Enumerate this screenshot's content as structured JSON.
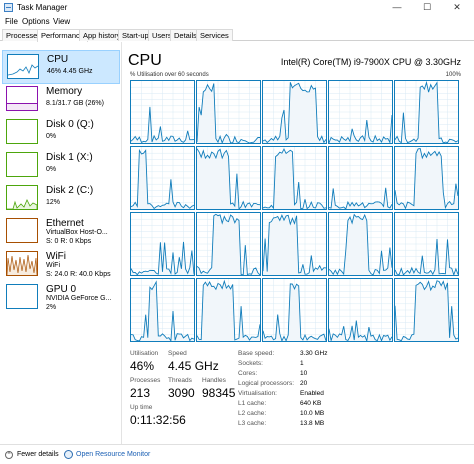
{
  "window": {
    "title": "Task Manager",
    "buttons": {
      "minimize": "—",
      "maximize": "☐",
      "close": "✕"
    }
  },
  "menu": [
    "File",
    "Options",
    "View"
  ],
  "tabs": [
    "Processes",
    "Performance",
    "App history",
    "Start-up",
    "Users",
    "Details",
    "Services"
  ],
  "active_tab": "Performance",
  "sidebar": [
    {
      "name": "CPU",
      "sub1": "46% 4.45 GHz",
      "sub2": "",
      "color": "#117dbb"
    },
    {
      "name": "Memory",
      "sub1": "8.1/31.7 GB (26%)",
      "sub2": "",
      "color": "#8b12ae"
    },
    {
      "name": "Disk 0 (Q:)",
      "sub1": "0%",
      "sub2": "",
      "color": "#4da60c"
    },
    {
      "name": "Disk 1 (X:)",
      "sub1": "0%",
      "sub2": "",
      "color": "#4da60c"
    },
    {
      "name": "Disk 2 (C:)",
      "sub1": "12%",
      "sub2": "",
      "color": "#4da60c"
    },
    {
      "name": "Ethernet",
      "sub1": "VirtualBox Host-O...",
      "sub2": "S: 0 R: 0 Kbps",
      "color": "#a74f01"
    },
    {
      "name": "WiFi",
      "sub1": "WiFi",
      "sub2": "S: 24.0 R: 40.0 Kbps",
      "color": "#a74f01"
    },
    {
      "name": "GPU 0",
      "sub1": "NVIDIA GeForce G...",
      "sub2": "2%",
      "color": "#117dbb"
    }
  ],
  "main": {
    "heading": "CPU",
    "model": "Intel(R) Core(TM) i9-7900X CPU @ 3.30GHz",
    "util_label": "% Utilisation over 60 seconds",
    "util_max": "100%"
  },
  "stats": {
    "utilisation_label": "Utilisation",
    "utilisation": "46%",
    "speed_label": "Speed",
    "speed": "4.45 GHz",
    "processes_label": "Processes",
    "processes": "213",
    "threads_label": "Threads",
    "threads": "3090",
    "handles_label": "Handles",
    "handles": "98345",
    "uptime_label": "Up time",
    "uptime": "0:11:32:56"
  },
  "info": [
    {
      "label": "Base speed:",
      "value": "3.30 GHz"
    },
    {
      "label": "Sockets:",
      "value": "1"
    },
    {
      "label": "Cores:",
      "value": "10"
    },
    {
      "label": "Logical processors:",
      "value": "20"
    },
    {
      "label": "Virtualisation:",
      "value": "Enabled"
    },
    {
      "label": "L1 cache:",
      "value": "640 KB"
    },
    {
      "label": "L2 cache:",
      "value": "10.0 MB"
    },
    {
      "label": "L3 cache:",
      "value": "13.8 MB"
    }
  ],
  "footer": {
    "fewer_details": "Fewer details",
    "open_resource_monitor": "Open Resource Monitor"
  },
  "colors": {
    "cpu_line": "#117dbb",
    "cpu_fill": "#f1f6fa",
    "grid": "#d9eaf4",
    "selected_bg": "#cce8ff"
  }
}
